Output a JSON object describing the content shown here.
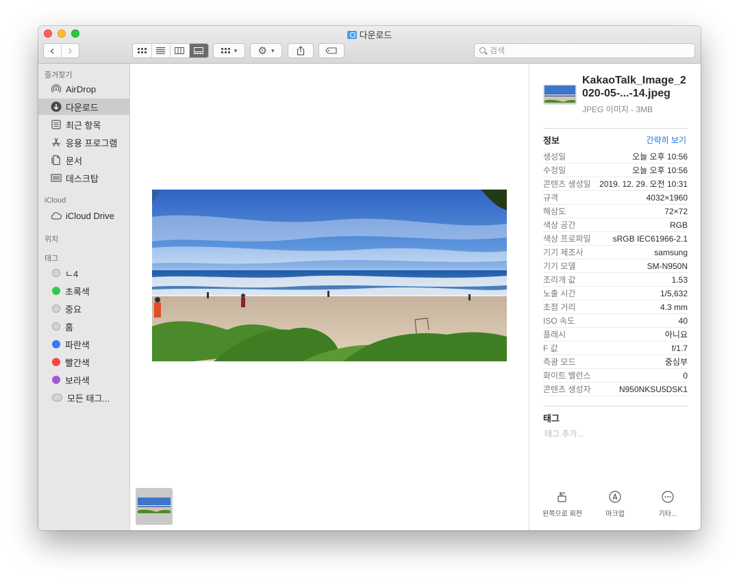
{
  "window": {
    "title": "다운로드"
  },
  "toolbar": {
    "back_label": "‹",
    "forward_label": "›",
    "search": {
      "placeholder": "검색"
    }
  },
  "sidebar": {
    "favorites_header": "즐겨찾기",
    "favorites": [
      {
        "label": "AirDrop",
        "icon": "airdrop-icon"
      },
      {
        "label": "다운로드",
        "icon": "download-icon",
        "selected": true
      },
      {
        "label": "최근 항목",
        "icon": "recents-icon"
      },
      {
        "label": "응용 프로그램",
        "icon": "applications-icon"
      },
      {
        "label": "문서",
        "icon": "document-icon"
      },
      {
        "label": "데스크탑",
        "icon": "desktop-icon"
      }
    ],
    "icloud_header": "iCloud",
    "icloud": [
      {
        "label": "iCloud Drive",
        "icon": "cloud-icon"
      }
    ],
    "locations_header": "위치",
    "tags_header": "태그",
    "tags": [
      {
        "label": "ㄴ4",
        "color": "#d4d4d4"
      },
      {
        "label": "초록색",
        "color": "#34c84a"
      },
      {
        "label": "중요",
        "color": "#d4d4d4"
      },
      {
        "label": "홈",
        "color": "#d4d4d4"
      },
      {
        "label": "파란색",
        "color": "#2f7cf6"
      },
      {
        "label": "빨간색",
        "color": "#f5463f"
      },
      {
        "label": "보라색",
        "color": "#a35ad0"
      },
      {
        "label": "모든 태그...",
        "color": "#d4d4d4"
      }
    ]
  },
  "inspector": {
    "file_name": "KakaoTalk_Image_2020-05-...-14.jpeg",
    "file_kind": "JPEG 이미지 - 3MB",
    "info_header": "정보",
    "less_info_link": "간략히 보기",
    "info": [
      {
        "k": "생성일",
        "v": "오늘 오후 10:56"
      },
      {
        "k": "수정일",
        "v": "오늘 오후 10:56"
      },
      {
        "k": "콘텐츠 생성일",
        "v": "2019. 12. 29. 오전 10:31"
      },
      {
        "k": "규격",
        "v": "4032×1960"
      },
      {
        "k": "해상도",
        "v": "72×72"
      },
      {
        "k": "색상 공간",
        "v": "RGB"
      },
      {
        "k": "색상 프로파일",
        "v": "sRGB IEC61966-2.1"
      },
      {
        "k": "기기 제조사",
        "v": "samsung"
      },
      {
        "k": "기기 모델",
        "v": "SM-N950N"
      },
      {
        "k": "조리개 값",
        "v": "1.53"
      },
      {
        "k": "노출 시간",
        "v": "1/5,632"
      },
      {
        "k": "초점 거리",
        "v": "4.3 mm"
      },
      {
        "k": "ISO 속도",
        "v": "40"
      },
      {
        "k": "플래시",
        "v": "아니요"
      },
      {
        "k": "F 값",
        "v": "f/1.7"
      },
      {
        "k": "측광 모드",
        "v": "중심부"
      },
      {
        "k": "화이트 밸런스",
        "v": "0"
      },
      {
        "k": "콘텐츠 생성자",
        "v": "N950NKSU5DSK1"
      }
    ],
    "tags_header": "태그",
    "tags_placeholder": "태그 추가...",
    "actions": [
      {
        "label": "왼쪽으로 회전",
        "icon": "rotate-left-icon"
      },
      {
        "label": "마크업",
        "icon": "markup-icon"
      },
      {
        "label": "기타...",
        "icon": "more-icon"
      }
    ]
  }
}
